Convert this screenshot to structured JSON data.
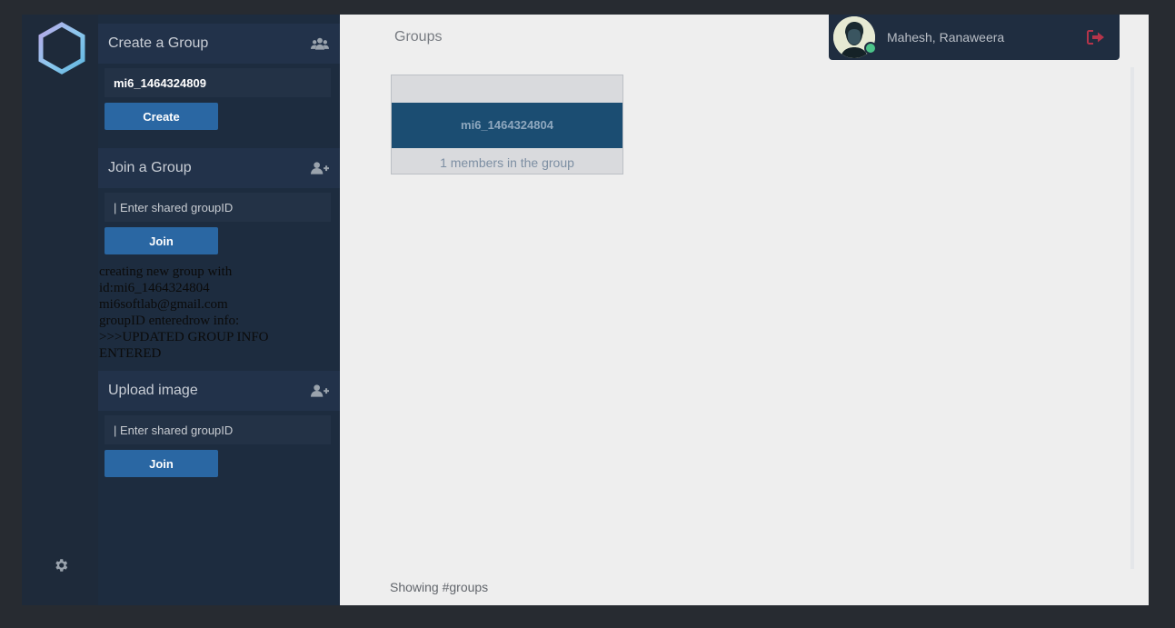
{
  "sidebar": {
    "logo_icon": "hexagon-logo-icon",
    "settings_icon": "gear-icon"
  },
  "create_group": {
    "title": "Create a Group",
    "icon": "users-group-icon",
    "input_value": "mi6_1464324809",
    "button_label": "Create"
  },
  "join_group": {
    "title": "Join a Group",
    "icon": "user-plus-icon",
    "input_placeholder": "| Enter shared groupID",
    "button_label": "Join"
  },
  "log": {
    "lines": [
      "creating new group with",
      "id:mi6_1464324804",
      "mi6softlab@gmail.com",
      "groupID enteredrow info:",
      ">>>UPDATED GROUP INFO",
      "ENTERED"
    ]
  },
  "upload_image": {
    "title": "Upload image",
    "icon": "user-plus-icon",
    "input_placeholder": "| Enter shared groupID",
    "button_label": "Join"
  },
  "main": {
    "title": "Groups",
    "groups": [
      {
        "name": "mi6_1464324804",
        "members": "1 members in the group"
      }
    ],
    "footer": "Showing #groups"
  },
  "user": {
    "name": "Mahesh, Ranaweera",
    "status": "online",
    "logout_icon": "sign-out-icon"
  },
  "colors": {
    "background": "#272b31",
    "panel": "#1d2c3f",
    "button": "#2a67a3",
    "card_band": "#1b4d72",
    "main": "#eeeeee",
    "logout": "#b5344a",
    "online": "#4cc48a"
  }
}
